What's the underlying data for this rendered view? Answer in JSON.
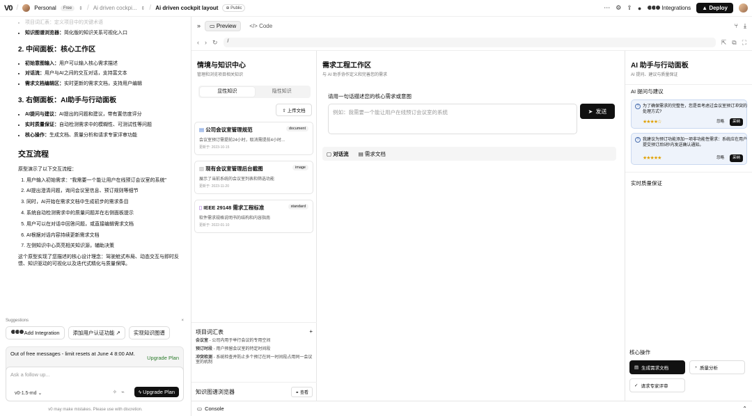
{
  "topbar": {
    "workspace": "Personal",
    "plan_badge": "Free",
    "project": "Ai driven cockpi...",
    "page_title": "Ai driven cockpit layout",
    "visibility": "Public",
    "integrations": "Integrations",
    "deploy": "Deploy"
  },
  "chat": {
    "faded_line": "项目词汇表：定义项目中的关键术语",
    "kg_line": {
      "label": "知识图谱浏览器：",
      "text": "简化版的知识关系可视化入口"
    },
    "section2": "2. 中间面板：核心工作区",
    "s2_items": [
      {
        "label": "初始意图输入：",
        "text": "用户可以输入核心需求描述"
      },
      {
        "label": "对话流：",
        "text": "用户与AI之间的交互对话，支持富文本"
      },
      {
        "label": "需求文档编辑区：",
        "text": "实时更新的需求文档，支持用户编辑"
      }
    ],
    "section3": "3. 右侧面板：AI助手与行动面板",
    "s3_items": [
      {
        "label": "AI提问与建议：",
        "text": "AI提出的问题和建议，带有置信度评分"
      },
      {
        "label": "实时质量保证：",
        "text": "自动检测需求中的模糊性、可测试性等问题"
      },
      {
        "label": "核心操作：",
        "text": "生成文档、质量分析和请求专家评审功能"
      }
    ],
    "flow_title": "交互流程",
    "flow_intro": "原型演示了以下交互流程：",
    "flow_steps": [
      "用户输入初始需求：\"我需要一个能让用户在线预订会议室的系统\"",
      "AI提出澄清问题，询问会议室信息、预订规则等细节",
      "同时，AI开始在需求文档中生成初步的需求条目",
      "系统自动检测需求中的质量问题并在右侧面板提示",
      "用户可以在对话中回答问题，或直接编辑需求文档",
      "AI根据对话内容持续更新需求文档",
      "左侧知识中心高亮相关知识源，辅助决策"
    ],
    "summary": "这个原型实现了您描述的核心设计理念：驾驶舱式布局、动态交互与即时反馈、知识驱动的可视化以及迭代式精化与质量保障。",
    "suggestions_title": "Suggestions",
    "suggestions": [
      "Add Integration",
      "添加用户认证功能 ↗",
      "实现知识图谱"
    ],
    "limit_text": "Out of free messages - limit resets at June 4 8:00 AM.",
    "upgrade_link": "Upgrade Plan",
    "composer_placeholder": "Ask a follow up...",
    "model": "v0-1.5-md",
    "upgrade_btn": "Upgrade Plan",
    "disclaimer": "v0 may make mistakes. Please use with discretion."
  },
  "preview": {
    "tab_preview": "Preview",
    "tab_code": "Code",
    "url": "/",
    "console": "Console"
  },
  "app": {
    "left": {
      "title": "情境与知识中心",
      "subtitle": "管理和浏览项目相关知识",
      "seg_explicit": "显性知识",
      "seg_implicit": "隐性知识",
      "upload": "上传文档",
      "cards": [
        {
          "title": "公司会议室管理规范",
          "tag": "document",
          "desc": "会议室预订需提前24小时，取消需提前4小时...",
          "updated": "更新于: 2023-10-15"
        },
        {
          "title": "现有会议室管理后台截图",
          "tag": "image",
          "desc": "展示了当前系统的会议室列表和筛选功能",
          "updated": "更新于: 2023-11-20"
        },
        {
          "title": "IEEE 29148 需求工程标准",
          "tag": "standard",
          "desc": "软件需求规格说明书的结构和内容指南",
          "updated": "更新于: 2022-01-10"
        }
      ],
      "glossary_title": "项目词汇表",
      "glossary": [
        {
          "term": "会议室",
          "def": " - 公司内用于举行会议的专用空间"
        },
        {
          "term": "预订时段",
          "def": " - 用户预留会议室的特定时间段"
        },
        {
          "term": "冲突检测",
          "def": " - 系统检查并防止多个预订在同一时间段占用同一会议室的机制"
        }
      ],
      "kg_title": "知识图谱浏览器",
      "kg_view": "查看"
    },
    "center": {
      "title": "需求工程工作区",
      "subtitle": "与 AI 助手协作定义和完善您的需求",
      "prompt_label": "请用一句话描述您的核心需求或意图",
      "prompt_placeholder": "例如：我需要一个能让用户在线预订会议室的系统",
      "send": "发送",
      "tab_dialog": "对话流",
      "tab_doc": "需求文档"
    },
    "right": {
      "title": "AI 助手与行动面板",
      "subtitle": "AI 提问、建议与质量保证",
      "section_suggest": "AI 提问与建议",
      "suggestions": [
        {
          "text": "为了确保需求的完整性，您是否考虑过会议室预订冲突的处理方式?",
          "stars": "★★★★☆",
          "ignore": "忽略",
          "adopt": "采纳"
        },
        {
          "text": "我建议为预订功能添加一项非功能性需求：系统应在用户提交预订后5秒内发送确认通知。",
          "stars": "★★★★★",
          "ignore": "忽略",
          "adopt": "采纳"
        }
      ],
      "section_qa": "实时质量保证",
      "section_ops": "核心操作",
      "ops": [
        "生成需求文档",
        "质量分析",
        "请求专家评审"
      ]
    }
  }
}
